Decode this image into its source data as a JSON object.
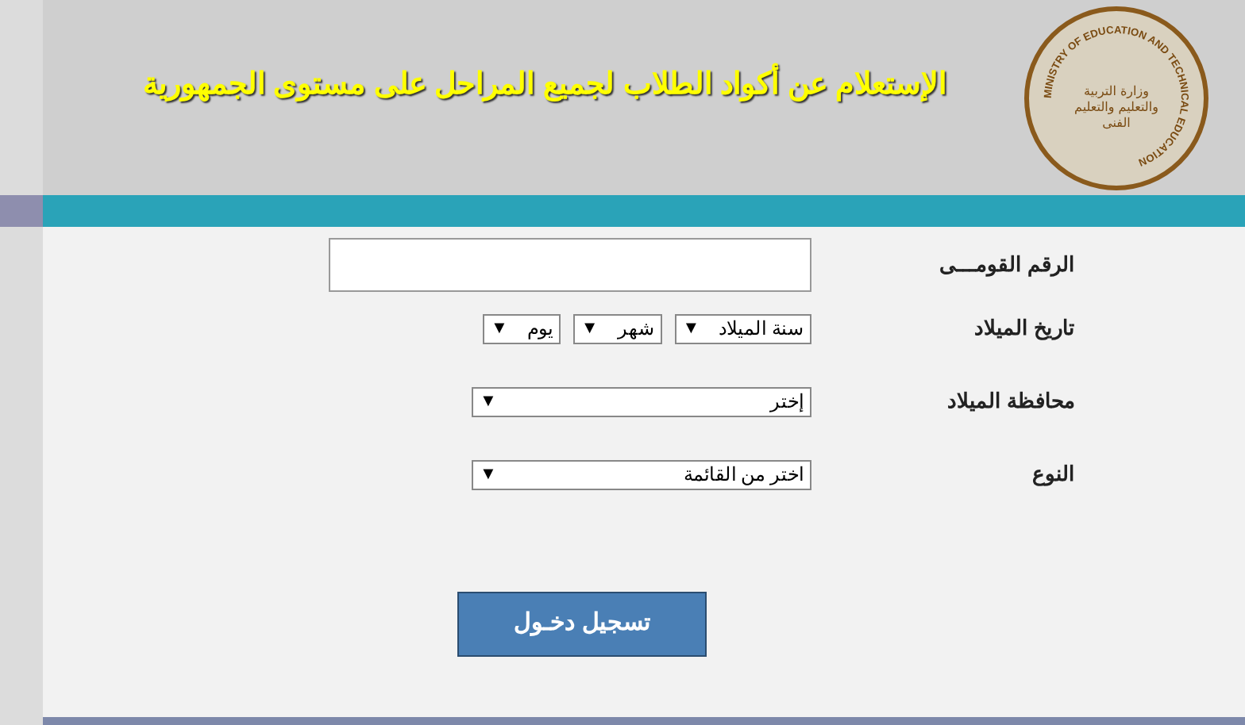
{
  "header": {
    "title": "الإستعلام عن أكواد الطلاب لجميع المراحل على مستوى الجمهورية",
    "logo_text": "MINISTRY OF EDUCATION AND TECHNICAL EDUCATION",
    "logo_arabic": "وزارة التربية والتعليم والتعليم الفنى"
  },
  "form": {
    "rows": [
      {
        "label": "الرقم القومـــى",
        "kind": "input"
      },
      {
        "label": "تاريخ الميلاد",
        "kind": "selects",
        "selects": [
          {
            "value": "سنة الميلاد",
            "arrow": "▼"
          },
          {
            "value": "شهر",
            "arrow": "▼"
          },
          {
            "value": "يوم",
            "arrow": "▼"
          }
        ]
      },
      {
        "label": "محافظة الميلاد",
        "kind": "selects",
        "selects": [
          {
            "value": "إختر",
            "arrow": "▼",
            "wide": true
          }
        ]
      },
      {
        "label": "النوع",
        "kind": "selects",
        "selects": [
          {
            "value": "اختر من القائمة",
            "arrow": "▼",
            "wide": true
          }
        ]
      }
    ],
    "submit": "تسجيل دخـول"
  }
}
